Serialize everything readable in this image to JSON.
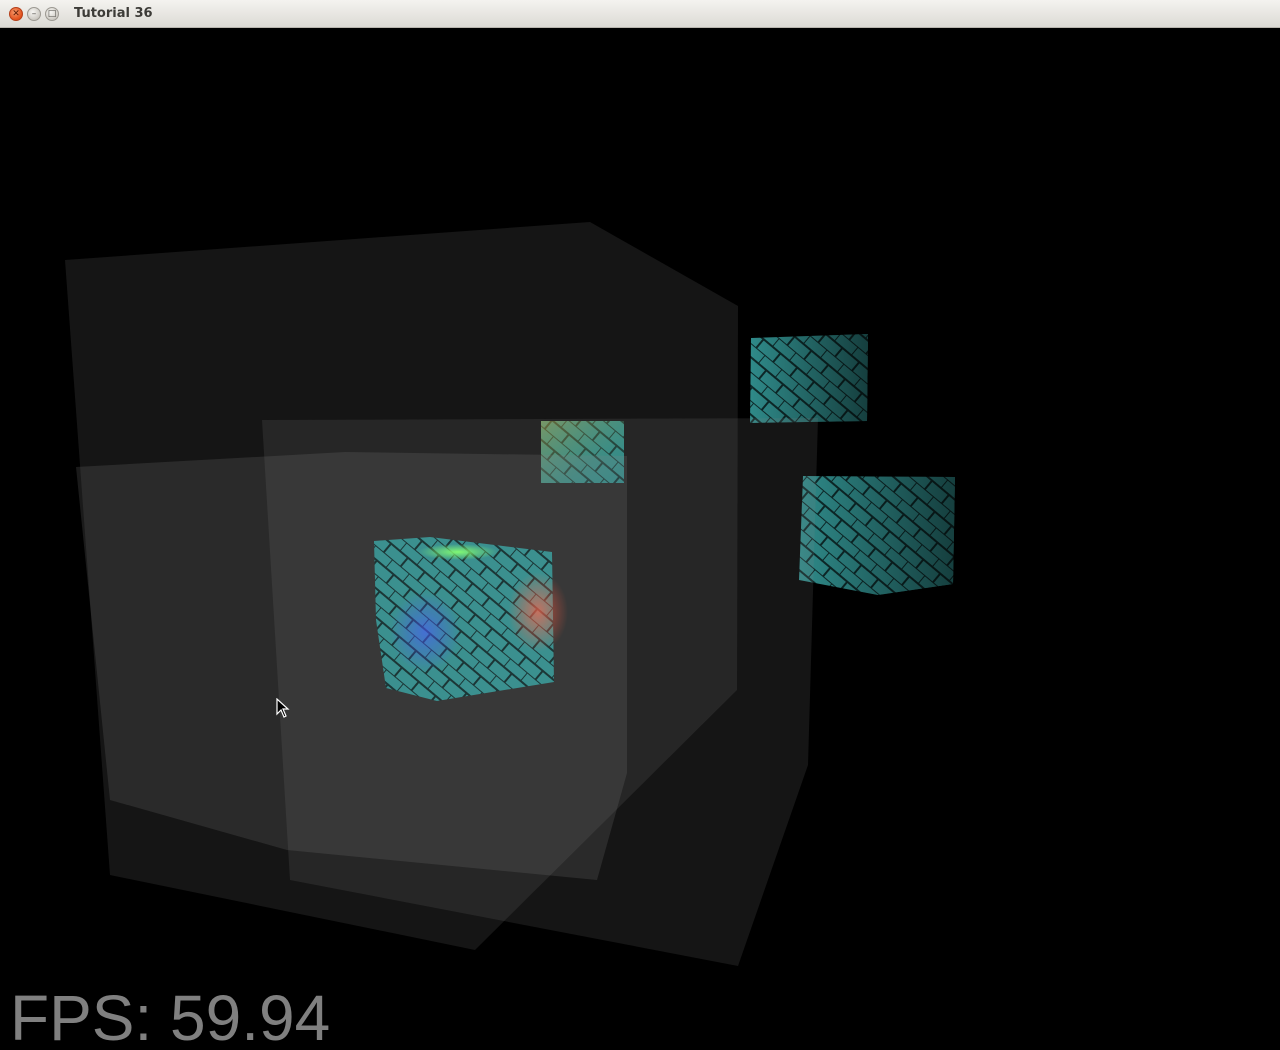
{
  "window": {
    "title": "Tutorial 36",
    "controls": {
      "close_icon": "close-icon",
      "minimize_icon": "minimize-icon",
      "maximize_icon": "maximize-icon"
    }
  },
  "viewport": {
    "background": "#000000",
    "fps_text": "FPS: 59.94",
    "cubes_color": "#3a8f8f",
    "transparent_panel_color": "#808080"
  },
  "cursor": {
    "icon": "arrow-cursor-icon"
  }
}
